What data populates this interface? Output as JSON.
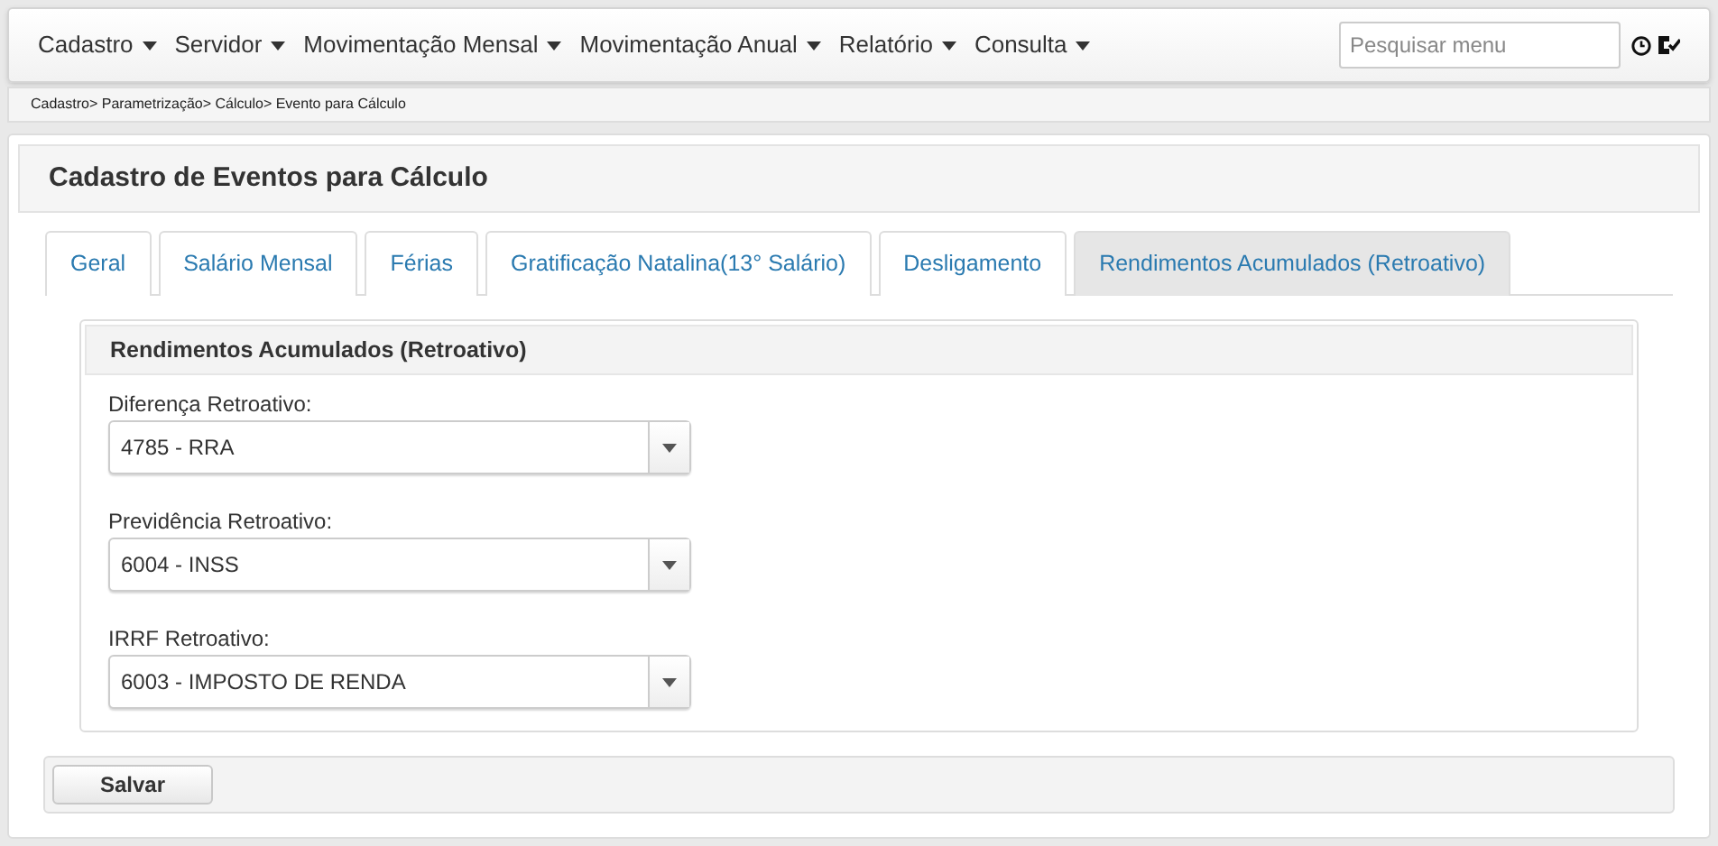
{
  "menu": [
    {
      "label": "Cadastro"
    },
    {
      "label": "Servidor"
    },
    {
      "label": "Movimentação Mensal"
    },
    {
      "label": "Movimentação Anual"
    },
    {
      "label": "Relatório"
    },
    {
      "label": "Consulta"
    }
  ],
  "search": {
    "placeholder": "Pesquisar menu"
  },
  "breadcrumb": "Cadastro> Parametrização> Cálculo> Evento para Cálculo",
  "page_title": "Cadastro de Eventos para Cálculo",
  "tabs": [
    {
      "label": "Geral",
      "selected": false
    },
    {
      "label": "Salário Mensal",
      "selected": false
    },
    {
      "label": "Férias",
      "selected": false
    },
    {
      "label": "Gratificação Natalina(13° Salário)",
      "selected": false
    },
    {
      "label": "Desligamento",
      "selected": false
    },
    {
      "label": "Rendimentos Acumulados (Retroativo)",
      "selected": true
    }
  ],
  "section_title": "Rendimentos Acumulados (Retroativo)",
  "fields": [
    {
      "label": "Diferença Retroativo:",
      "value": "4785 - RRA"
    },
    {
      "label": "Previdência Retroativo:",
      "value": "6004 - INSS"
    },
    {
      "label": "IRRF Retroativo:",
      "value": "6003 - IMPOSTO DE RENDA"
    }
  ],
  "save_button": "Salvar"
}
